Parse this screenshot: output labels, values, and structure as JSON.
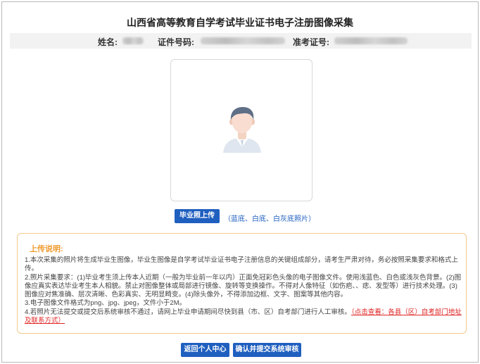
{
  "header": {
    "title": "山西省高等教育自学考试毕业证书电子注册图像采集"
  },
  "info": {
    "name_label": "姓名:",
    "id_label": "证件号码:",
    "exam_label": "准考证号:"
  },
  "photo": {
    "icon": "person-avatar-icon"
  },
  "upload": {
    "button_label": "毕业照上传",
    "hint": "（蓝底、白底、白灰底照片）"
  },
  "notice": {
    "title": "上传说明:",
    "p1": "1.本次采集的照片将生成毕业生图像，毕业生图像是自学考试毕业证书电子注册信息的关键组成部分，请考生严肃对待，务必按照采集要求和格式上传。",
    "p2": "2.照片采集要求：(1)毕业考生须上传本人近期（一般为毕业前一年以内）正面免冠彩色头像的电子图像文件。使用浅蓝色、白色或浅灰色背景。(2)图像应真实表达毕业考生本人相貌。禁止对图像整体或局部进行镜像、旋转等变换操作。不得对人像特征（如伤疤、、痣、发型等）进行技术处理。(3)图像应对焦准确、层次清晰、色彩真实、无明显畸变。(4)除头像外，不得添加边框、文字、图案等其他内容。",
    "p3": "3.电子图像文件格式为png、jpg、jpeg，文件小于2M。",
    "p4": "4.若照片无法提交或提交后系统审核不通过，请网上毕业申请期间尽快到县（市、区）自考部门进行人工审核。",
    "p4_link": "（点击查看：各县（区）自考部门地址及联系方式）"
  },
  "actions": {
    "back_label": "返回个人中心",
    "submit_label": "确认并提交系统审核"
  },
  "colors": {
    "primary": "#1f5fbf",
    "notice_title": "#ef9a2e",
    "notice_border": "#f3c98b",
    "link_red": "#e02424"
  }
}
